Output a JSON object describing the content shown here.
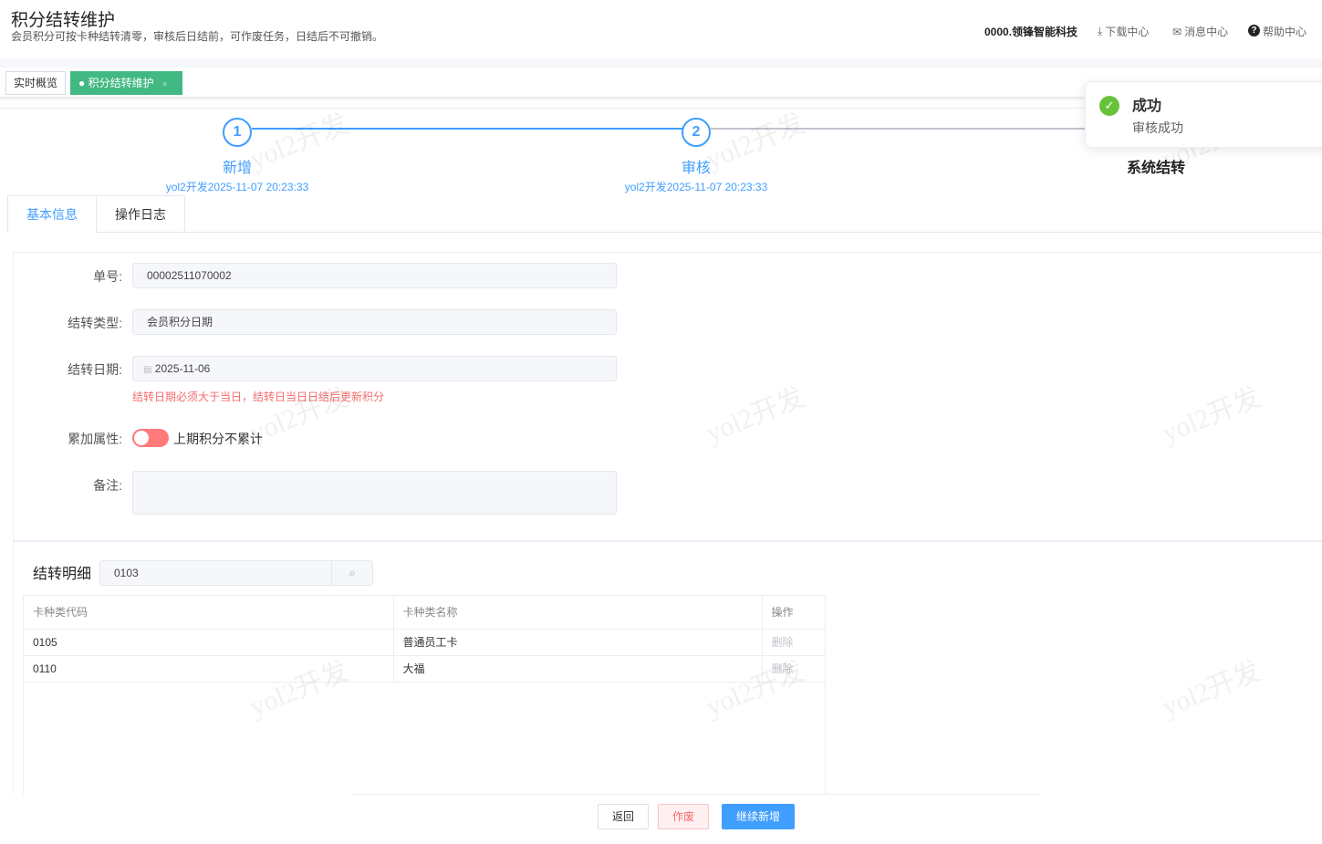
{
  "header": {
    "title": "积分结转维护",
    "subtitle": "会员积分可按卡种结转清零，审核后日结前，可作废任务，日结后不可撤销。",
    "company": "0000.领锋智能科技",
    "download": "下载中心",
    "messages": "消息中心",
    "help": "帮助中心"
  },
  "tabs": [
    {
      "label": "实时概览"
    },
    {
      "label": "积分结转维护"
    }
  ],
  "steps": [
    {
      "num": "1",
      "title": "新增",
      "desc": "yol2开发2025-11-07 20:23:33"
    },
    {
      "num": "2",
      "title": "审核",
      "desc": "yol2开发2025-11-07 20:23:33"
    },
    {
      "title": "系统结转"
    }
  ],
  "detail_tabs": [
    "基本信息",
    "操作日志"
  ],
  "form": {
    "no_label": "单号:",
    "no_value": "00002511070002",
    "type_label": "结转类型:",
    "type_value": "会员积分日期",
    "date_label": "结转日期:",
    "date_value": "2025-11-06",
    "date_hint": "结转日期必须大于当日，结转日当日日结后更新积分",
    "accum_label": "累加属性:",
    "accum_text": "上期积分不累计",
    "accum_on": false,
    "remark_label": "备注:",
    "remark_value": ""
  },
  "detail": {
    "title": "结转明细",
    "search_value": "0103",
    "columns": [
      "卡种类代码",
      "卡种类名称",
      "操作"
    ],
    "rows": [
      {
        "code": "0105",
        "name": "普通员工卡",
        "action": "删除"
      },
      {
        "code": "0110",
        "name": "大福",
        "action": "删除"
      }
    ]
  },
  "buttons": {
    "back": "返回",
    "void": "作废",
    "continue": "继续新增"
  },
  "toast": {
    "title": "成功",
    "message": "审核成功"
  },
  "watermark": "yol2开发",
  "colors": {
    "primary": "#409eff",
    "success": "#42b983",
    "danger": "#f56c6c"
  }
}
